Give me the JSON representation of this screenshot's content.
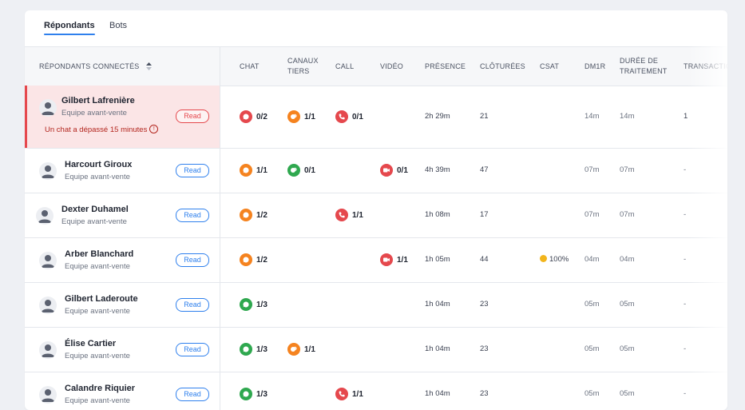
{
  "tabs": [
    {
      "label": "Répondants"
    },
    {
      "label": "Bots"
    }
  ],
  "headers": {
    "responders": "Répondants connectés",
    "chat": "Chat",
    "canaux_tiers": [
      "Canaux",
      "tiers"
    ],
    "call": "Call",
    "video": "Vidéo",
    "presence": "Présence",
    "closed": "Clôturées",
    "csat": "CSAT",
    "dm1r": "DM1R",
    "duration": [
      "Durée de",
      "traitement"
    ],
    "transactions": "Transactio"
  },
  "read_label": "Read",
  "rows": [
    {
      "name": "Gilbert Lafrenière",
      "team": "Equipe avant-vente",
      "alert": "Un chat a dépassé 15 minutes",
      "chat": "0/2",
      "third": "1/1",
      "call": "0/1",
      "video": "",
      "presence": "2h 29m",
      "closed": "21",
      "csat": "",
      "dm1r": "14m",
      "duration": "14m",
      "trans": "1"
    },
    {
      "name": "Harcourt Giroux",
      "team": "Equipe avant-vente",
      "chat": "1/1",
      "third": "0/1",
      "call": "",
      "video": "0/1",
      "presence": "4h 39m",
      "closed": "47",
      "csat": "",
      "dm1r": "07m",
      "duration": "07m",
      "trans": "-"
    },
    {
      "name": "Dexter Duhamel",
      "team": "Equipe avant-vente",
      "chat": "1/2",
      "third": "",
      "call": "1/1",
      "video": "",
      "presence": "1h 08m",
      "closed": "17",
      "csat": "",
      "dm1r": "07m",
      "duration": "07m",
      "trans": "-"
    },
    {
      "name": "Arber Blanchard",
      "team": "Equipe avant-vente",
      "chat": "1/2",
      "third": "",
      "call": "",
      "video": "1/1",
      "presence": "1h 05m",
      "closed": "44",
      "csat": "100%",
      "dm1r": "04m",
      "duration": "04m",
      "trans": "-"
    },
    {
      "name": "Gilbert Laderoute",
      "team": "Equipe avant-vente",
      "chat": "1/3",
      "third": "",
      "call": "",
      "video": "",
      "presence": "1h 04m",
      "closed": "23",
      "csat": "",
      "dm1r": "05m",
      "duration": "05m",
      "trans": "-"
    },
    {
      "name": "Élise Cartier",
      "team": "Equipe avant-vente",
      "chat": "1/3",
      "third": "1/1",
      "call": "",
      "video": "",
      "presence": "1h 04m",
      "closed": "23",
      "csat": "",
      "dm1r": "05m",
      "duration": "05m",
      "trans": "-"
    },
    {
      "name": "Calandre Riquier",
      "team": "Equipe avant-vente",
      "chat": "1/3",
      "third": "",
      "call": "1/1",
      "video": "",
      "presence": "1h 04m",
      "closed": "23",
      "csat": "",
      "dm1r": "05m",
      "duration": "05m",
      "trans": "-"
    }
  ],
  "colors": {
    "accent": "#2f80ed",
    "alert": "#e5484d",
    "orange": "#f5831f",
    "green": "#2fa84f"
  },
  "icons": {
    "chat": "chat-bubble-icon",
    "third": "third-party-channel-icon",
    "call": "phone-icon",
    "video": "video-camera-icon",
    "csat": "smiley-icon",
    "avatar": "user-avatar-icon"
  }
}
